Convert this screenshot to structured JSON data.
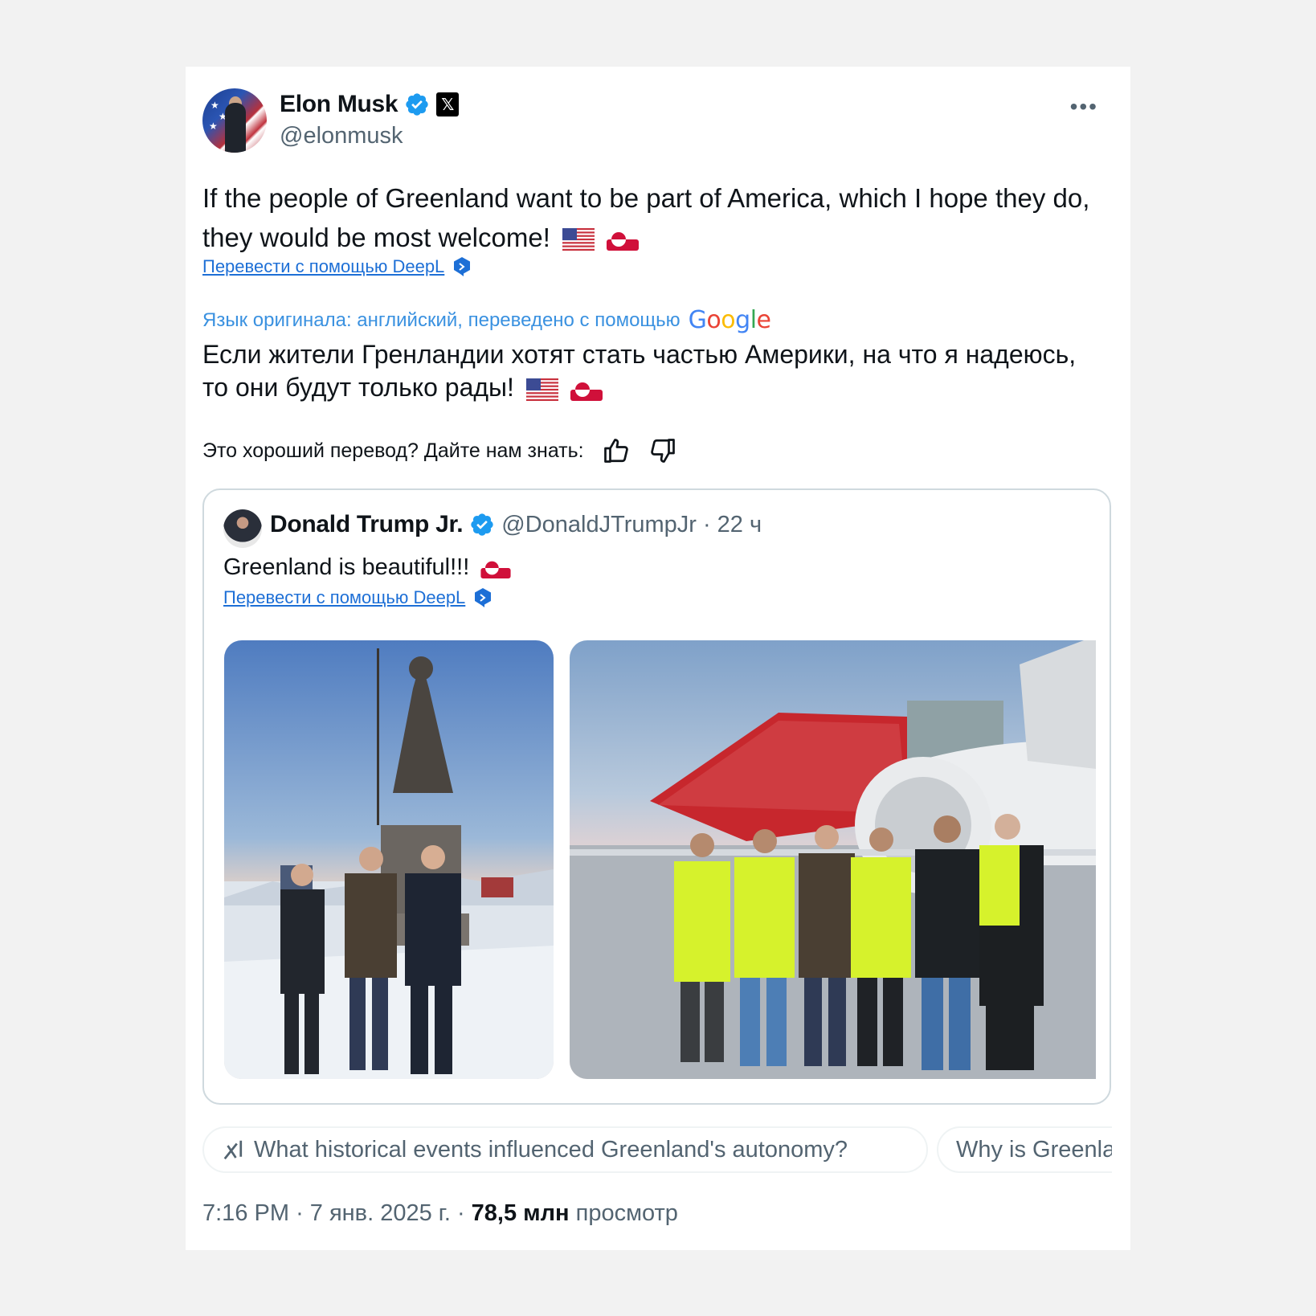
{
  "tweet": {
    "author_name": "Elon Musk",
    "author_handle": "@elonmusk",
    "more_label": "•••",
    "text": "If the people of Greenland want to be part of America, which I hope they do, they would be most welcome!",
    "translate_link": "Перевести с помощью DeepL",
    "original_language_note": "Язык оригинала: английский, переведено с помощью",
    "google_label": "Google",
    "translated_text": "Если жители Гренландии хотят стать частью Америки, на что я надеюсь, то они будут только рады!",
    "feedback_prompt": "Это хороший перевод? Дайте нам знать:",
    "time": "7:16 PM",
    "date": "7 янв. 2025 г.",
    "views_count": "78,5 млн",
    "views_label": "просмотр"
  },
  "quoted": {
    "author_name": "Donald Trump Jr.",
    "author_handle": "@DonaldJTrumpJr",
    "age": "22 ч",
    "text": "Greenland is beautiful!!!",
    "translate_link": "Перевести с помощью DeepL"
  },
  "suggestions": [
    {
      "label": "What historical events influenced Greenland's autonomy?"
    },
    {
      "label": "Why is Greenla"
    }
  ],
  "icons": {
    "verified": "verified-badge-icon",
    "x_affiliate": "x-logo-icon",
    "more": "more-icon",
    "deepl": "deepl-icon",
    "thumbs_up": "thumbs-up-icon",
    "thumbs_down": "thumbs-down-icon",
    "grok": "grok-icon"
  },
  "colors": {
    "link": "#1d6fd6",
    "verified": "#1d9bf0",
    "muted": "#536471",
    "border": "#cfd9de"
  }
}
